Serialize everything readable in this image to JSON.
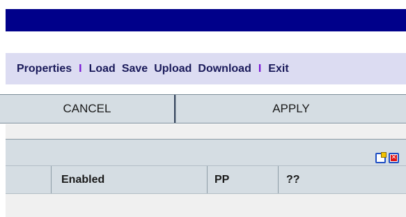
{
  "menu": {
    "properties": "Properties",
    "sep1": "I",
    "load": "Load",
    "save": "Save",
    "upload": "Upload",
    "download": "Download",
    "sep2": "I",
    "exit": "Exit"
  },
  "buttons": {
    "cancel": "CANCEL",
    "apply": "APPLY"
  },
  "toolbar": {
    "edit_icon": "edit-icon",
    "close_icon": "close-icon",
    "close_glyph": "✕"
  },
  "table": {
    "columns": [
      "",
      "Enabled",
      "PP",
      "??"
    ]
  }
}
